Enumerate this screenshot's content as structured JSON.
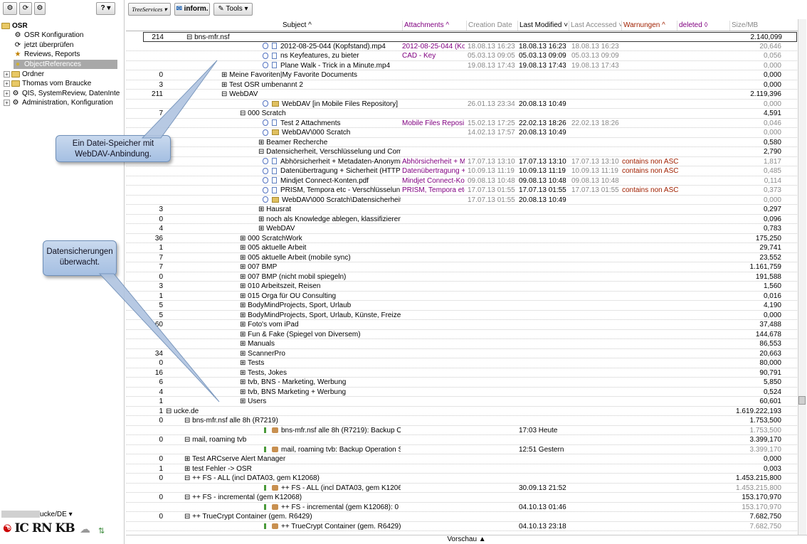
{
  "left_toolbar": {
    "help_label": "? ▾"
  },
  "left_tree": [
    {
      "label": "OSR",
      "icon": "folder-icon"
    },
    {
      "label": "OSR Konfiguration",
      "icon": "gears-icon"
    },
    {
      "label": "jetzt überprüfen",
      "icon": "refresh-icon"
    },
    {
      "label": "Reviews, Reports",
      "icon": "star-icon"
    },
    {
      "label": "ObjectReferences",
      "icon": "db-icon"
    },
    {
      "label": "Ordner",
      "icon": "folder-icon"
    },
    {
      "label": "Thomas vom Braucke",
      "icon": "folder-icon"
    },
    {
      "label": "QIS, SystemReview, DatenInte",
      "icon": "gears-icon"
    },
    {
      "label": "Administration, Konfiguration",
      "icon": "gears-icon"
    }
  ],
  "left_bottom": {
    "user_label": "ucke/DE ▾",
    "logo_text": "IC RN KB"
  },
  "top_toolbar": {
    "treeservices_label": "TreeServices ▾",
    "inform_label": "inform.",
    "tools_label": "Tools ▾"
  },
  "columns": {
    "subject": "Subject ^",
    "attachments": "Attachments ^",
    "creation": "Creation Date",
    "modified": "Last Modified ˅",
    "accessed": "Last Accessed ˅",
    "warnungen": "Warnungen ^",
    "deleted": "deleted ◊",
    "size": "Size/MB"
  },
  "rows": [
    {
      "num": "214",
      "sub": "⊟ bns-mfr.nsf",
      "ind": 84,
      "size": "2.140,099",
      "box": true
    },
    {
      "num": "",
      "sub": "2012-08-25-044 (Kopfstand).mp4",
      "ind": 192,
      "icon": "doc",
      "att": "2012-08-25-044 (Ko",
      "cre": "18.08.13 16:23",
      "mod": "18.08.13 16:23",
      "acc": "18.08.13 16:23",
      "size": "20,646",
      "g": true
    },
    {
      "num": "",
      "sub": "ns            Keyfeatures, zu bieter",
      "ind": 192,
      "icon": "doc",
      "att": "          CAD - Key",
      "cre": "05.03.13 09:05",
      "mod": "05.03.13 09:09",
      "acc": "05.03.13 09:09",
      "size": "0,056",
      "g": true
    },
    {
      "num": "",
      "sub": "Plane Walk - Trick in a Minute.mp4",
      "ind": 192,
      "icon": "doc",
      "att": "",
      "cre": "19.08.13 17:43",
      "mod": "19.08.13 17:43",
      "acc": "19.08.13 17:43",
      "size": "0,000",
      "g": true
    },
    {
      "num": "0",
      "sub": "⊞ Meine Favoriten|My Favorite Documents",
      "ind": 134,
      "size": "0,000"
    },
    {
      "num": "3",
      "sub": "⊞ Test OSR umbenannt 2",
      "ind": 134,
      "size": "0,000"
    },
    {
      "num": "211",
      "sub": "⊟ WebDAV",
      "ind": 134,
      "size": "2.119,396"
    },
    {
      "num": "",
      "sub": "WebDAV [in Mobile Files Repository]",
      "ind": 192,
      "icon": "fol",
      "cre": "26.01.13 23:34",
      "mod": "20.08.13 10:49",
      "size": "0,000",
      "g": true
    },
    {
      "num": "7",
      "sub": "⊟ 000 Scratch",
      "ind": 160,
      "size": "4,591"
    },
    {
      "num": "",
      "sub": "Test 2 Attachments",
      "ind": 192,
      "icon": "doc",
      "att": "Mobile Files Reposi",
      "cre": "15.02.13 17:25",
      "mod": "22.02.13 18:26",
      "acc": "22.02.13 18:26",
      "size": "0,046",
      "g": true
    },
    {
      "num": "",
      "sub": "WebDAV\\000 Scratch",
      "ind": 192,
      "icon": "fol",
      "cre": "14.02.13 17:57",
      "mod": "20.08.13 10:49",
      "size": "0,000",
      "g": true
    },
    {
      "num": "0",
      "sub": "⊞ Beamer Recherche",
      "ind": 186,
      "size": "0,580"
    },
    {
      "num": "0",
      "sub": "⊟ Datensicherheit, Verschlüsselung und Compliance",
      "ind": 186,
      "size": "2,790"
    },
    {
      "num": "",
      "sub": "Abhörsicherheit + Metadaten-Anonymi",
      "ind": 192,
      "icon": "doc",
      "att": "Abhörsicherheit + M",
      "cre": "17.07.13 13:10",
      "mod": "17.07.13 13:10",
      "acc": "17.07.13 13:10",
      "war": "contains non ASC",
      "size": "1,817",
      "g": true
    },
    {
      "num": "",
      "sub": "Datenübertragung + Sicherheit (HTTP",
      "ind": 192,
      "icon": "doc",
      "att": "Datenübertragung +",
      "cre": "10.09.13 11:19",
      "mod": "10.09.13 11:19",
      "acc": "10.09.13 11:19",
      "war": "contains non ASC",
      "size": "0,485",
      "g": true
    },
    {
      "num": "",
      "sub": "Mindjet Connect-Konten.pdf",
      "ind": 192,
      "icon": "doc",
      "att": "Mindjet Connect-Ko",
      "cre": "09.08.13 10:48",
      "mod": "09.08.13 10:48",
      "acc": "09.08.13 10:48",
      "size": "0,114",
      "g": true
    },
    {
      "num": "",
      "sub": "PRISM, Tempora etc - Verschlüsselun",
      "ind": 192,
      "icon": "doc",
      "att": "PRISM, Tempora etc",
      "cre": "17.07.13 01:55",
      "mod": "17.07.13 01:55",
      "acc": "17.07.13 01:55",
      "war": "contains non ASC",
      "size": "0,373",
      "g": true
    },
    {
      "num": "",
      "sub": "WebDAV\\000 Scratch\\Datensicherheit,",
      "ind": 192,
      "icon": "fol",
      "cre": "17.07.13 01:55",
      "mod": "20.08.13 10:49",
      "size": "0,000",
      "g": true
    },
    {
      "num": "3",
      "sub": "⊞ Hausrat",
      "ind": 186,
      "size": "0,297"
    },
    {
      "num": "0",
      "sub": "⊞ noch als Knowledge ablegen, klassifizieren",
      "ind": 186,
      "size": "0,096"
    },
    {
      "num": "4",
      "sub": "⊞ WebDAV",
      "ind": 186,
      "size": "0,783"
    },
    {
      "num": "36",
      "sub": "⊞ 000 ScratchWork",
      "ind": 160,
      "size": "175,250"
    },
    {
      "num": "1",
      "sub": "⊞ 005 aktuelle Arbeit",
      "ind": 160,
      "size": "29,741"
    },
    {
      "num": "7",
      "sub": "⊞ 005 aktuelle Arbeit (mobile sync)",
      "ind": 160,
      "size": "23,552"
    },
    {
      "num": "7",
      "sub": "⊞ 007 BMP",
      "ind": 160,
      "size": "1.161,759"
    },
    {
      "num": "0",
      "sub": "⊞ 007 BMP (nicht mobil spiegeln)",
      "ind": 160,
      "size": "191,588"
    },
    {
      "num": "3",
      "sub": "⊞ 010 Arbeitszeit, Reisen",
      "ind": 160,
      "size": "1,560"
    },
    {
      "num": "1",
      "sub": "⊞ 015 Orga für OU Consulting",
      "ind": 160,
      "size": "0,016"
    },
    {
      "num": "5",
      "sub": "⊞ BodyMindProjects, Sport, Urlaub",
      "ind": 160,
      "size": "4,190"
    },
    {
      "num": "5",
      "sub": "⊞ BodyMindProjects, Sport, Urlaub, Künste, Freizeit",
      "ind": 160,
      "size": "0,000"
    },
    {
      "num": "60",
      "sub": "⊞ Foto's vom iPad",
      "ind": 160,
      "size": "37,488"
    },
    {
      "num": "",
      "sub": "⊞ Fun & Fake (Spiegel von Diversem)",
      "ind": 160,
      "size": "144,678"
    },
    {
      "num": "",
      "sub": "⊞ Manuals",
      "ind": 160,
      "size": "86,553"
    },
    {
      "num": "34",
      "sub": "⊞ ScannerPro",
      "ind": 160,
      "size": "20,663"
    },
    {
      "num": "0",
      "sub": "⊞ Tests",
      "ind": 160,
      "size": "80,000"
    },
    {
      "num": "16",
      "sub": "⊞ Tests, Jokes",
      "ind": 160,
      "size": "90,791"
    },
    {
      "num": "6",
      "sub": "⊞ tvb, BNS - Marketing, Werbung",
      "ind": 160,
      "size": "5,850"
    },
    {
      "num": "4",
      "sub": "⊞ tvb, BNS Marketing + Werbung",
      "ind": 160,
      "size": "0,524"
    },
    {
      "num": "1",
      "sub": "⊞ Users",
      "ind": 160,
      "size": "60,601"
    },
    {
      "num": "1",
      "sub": "⊟              ucke.de",
      "ind": 56,
      "size": "1.619.222,193"
    },
    {
      "num": "0",
      "sub": "⊟ bns-mfr.nsf alle 8h (R7219)",
      "ind": 82,
      "size": "1.753,500"
    },
    {
      "num": "",
      "sub": "bns-mfr.nsf alle 8h (R7219): Backup O",
      "ind": 194,
      "icon": "bk",
      "mod": "17:03 Heute",
      "size": "1.753,500",
      "g": true
    },
    {
      "num": "0",
      "sub": "⊟ mail, roaming tvb",
      "ind": 82,
      "size": "3.399,170"
    },
    {
      "num": "",
      "sub": "mail, roaming tvb: Backup Operation S",
      "ind": 194,
      "icon": "bk",
      "mod": "12:51 Gestern",
      "size": "3.399,170",
      "g": true
    },
    {
      "num": "0",
      "sub": "⊞ Test ARCserve Alert Manager",
      "ind": 82,
      "size": "0,000"
    },
    {
      "num": "1",
      "sub": "⊞ test Fehler -> OSR",
      "ind": 82,
      "size": "0,003"
    },
    {
      "num": "0",
      "sub": "⊟ ++ FS - ALL (incl DATA03, gem K12068)",
      "ind": 82,
      "size": "1.453.215,800"
    },
    {
      "num": "",
      "sub": "++ FS - ALL (incl DATA03, gem K1206",
      "ind": 194,
      "icon": "bk",
      "mod": "30.09.13 21:52",
      "size": "1.453.215,800",
      "g": true
    },
    {
      "num": "0",
      "sub": "⊟ ++ FS - incremental (gem K12068)",
      "ind": 82,
      "size": "153.170,970"
    },
    {
      "num": "",
      "sub": "++ FS - incremental (gem K12068): 0 I",
      "ind": 194,
      "icon": "bk",
      "mod": "04.10.13 01:46",
      "size": "153.170,970",
      "g": true
    },
    {
      "num": "0",
      "sub": "⊟ ++ TrueCrypt Container (gem. R6429)",
      "ind": 82,
      "size": "7.682,750"
    },
    {
      "num": "",
      "sub": "++ TrueCrypt Container (gem. R6429):",
      "ind": 194,
      "icon": "bk",
      "mod": "04.10.13 23:18",
      "size": "7.682,750",
      "g": true
    }
  ],
  "callouts": {
    "webdav": "Ein Datei-Speicher mit WebDAV-Anbindung.",
    "backup": "Datensicherungen überwacht."
  },
  "footer": {
    "preview_label": "Vorschau ▲"
  }
}
